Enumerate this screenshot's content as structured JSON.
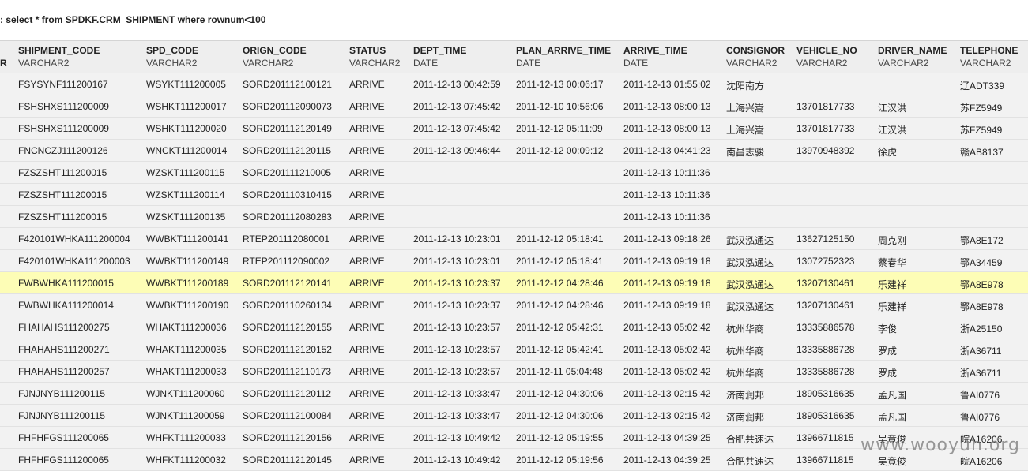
{
  "query_text": ": select * from SPDKF.CRM_SHIPMENT where rownum<100",
  "stub_label": "R",
  "columns": [
    {
      "name": "SHIPMENT_CODE",
      "type": "VARCHAR2"
    },
    {
      "name": "SPD_CODE",
      "type": "VARCHAR2"
    },
    {
      "name": "ORIGN_CODE",
      "type": "VARCHAR2"
    },
    {
      "name": "STATUS",
      "type": "VARCHAR2"
    },
    {
      "name": "DEPT_TIME",
      "type": "DATE"
    },
    {
      "name": "PLAN_ARRIVE_TIME",
      "type": "DATE"
    },
    {
      "name": "ARRIVE_TIME",
      "type": "DATE"
    },
    {
      "name": "CONSIGNOR",
      "type": "VARCHAR2"
    },
    {
      "name": "VEHICLE_NO",
      "type": "VARCHAR2"
    },
    {
      "name": "DRIVER_NAME",
      "type": "VARCHAR2"
    },
    {
      "name": "TELEPHONE",
      "type": "VARCHAR2"
    }
  ],
  "rows": [
    [
      "FSYSYNF111200167",
      "WSYKT111200005",
      "SORD201112100121",
      "ARRIVE",
      "2011-12-13 00:42:59",
      "2011-12-13 00:06:17",
      "2011-12-13 01:55:02",
      "沈阳南方",
      "",
      "",
      "辽ADT339"
    ],
    [
      "FSHSHXS111200009",
      "WSHKT111200017",
      "SORD201112090073",
      "ARRIVE",
      "2011-12-13 07:45:42",
      "2011-12-10 10:56:06",
      "2011-12-13 08:00:13",
      "上海兴嵩",
      "13701817733",
      "江汉洪",
      "苏FZ5949"
    ],
    [
      "FSHSHXS111200009",
      "WSHKT111200020",
      "SORD201112120149",
      "ARRIVE",
      "2011-12-13 07:45:42",
      "2011-12-12 05:11:09",
      "2011-12-13 08:00:13",
      "上海兴嵩",
      "13701817733",
      "江汉洪",
      "苏FZ5949"
    ],
    [
      "FNCNCZJ111200126",
      "WNCKT111200014",
      "SORD201112120115",
      "ARRIVE",
      "2011-12-13 09:46:44",
      "2011-12-12 00:09:12",
      "2011-12-13 04:41:23",
      "南昌志骏",
      "13970948392",
      "徐虎",
      "赣AB8137"
    ],
    [
      "FZSZSHT111200015",
      "WZSKT111200115",
      "SORD201111210005",
      "ARRIVE",
      "",
      "",
      "2011-12-13 10:11:36",
      "",
      "",
      "",
      ""
    ],
    [
      "FZSZSHT111200015",
      "WZSKT111200114",
      "SORD201110310415",
      "ARRIVE",
      "",
      "",
      "2011-12-13 10:11:36",
      "",
      "",
      "",
      ""
    ],
    [
      "FZSZSHT111200015",
      "WZSKT111200135",
      "SORD201112080283",
      "ARRIVE",
      "",
      "",
      "2011-12-13 10:11:36",
      "",
      "",
      "",
      ""
    ],
    [
      "F420101WHKA111200004",
      "WWBKT111200141",
      "RTEP201112080001",
      "ARRIVE",
      "2011-12-13 10:23:01",
      "2011-12-12 05:18:41",
      "2011-12-13 09:18:26",
      "武汉泓通达",
      "13627125150",
      "周克刚",
      "鄂A8E172"
    ],
    [
      "F420101WHKA111200003",
      "WWBKT111200149",
      "RTEP201112090002",
      "ARRIVE",
      "2011-12-13 10:23:01",
      "2011-12-12 05:18:41",
      "2011-12-13 09:19:18",
      "武汉泓通达",
      "13072752323",
      "蔡春华",
      "鄂A34459"
    ],
    [
      "FWBWHKA111200015",
      "WWBKT111200189",
      "SORD201112120141",
      "ARRIVE",
      "2011-12-13 10:23:37",
      "2011-12-12 04:28:46",
      "2011-12-13 09:19:18",
      "武汉泓通达",
      "13207130461",
      "乐建祥",
      "鄂A8E978"
    ],
    [
      "FWBWHKA111200014",
      "WWBKT111200190",
      "SORD201110260134",
      "ARRIVE",
      "2011-12-13 10:23:37",
      "2011-12-12 04:28:46",
      "2011-12-13 09:19:18",
      "武汉泓通达",
      "13207130461",
      "乐建祥",
      "鄂A8E978"
    ],
    [
      "FHAHAHS111200275",
      "WHAKT111200036",
      "SORD201112120155",
      "ARRIVE",
      "2011-12-13 10:23:57",
      "2011-12-12 05:42:31",
      "2011-12-13 05:02:42",
      "杭州华商",
      "13335886578",
      "李俊",
      "浙A25150"
    ],
    [
      "FHAHAHS111200271",
      "WHAKT111200035",
      "SORD201112120152",
      "ARRIVE",
      "2011-12-13 10:23:57",
      "2011-12-12 05:42:41",
      "2011-12-13 05:02:42",
      "杭州华商",
      "13335886728",
      "罗成",
      "浙A36711"
    ],
    [
      "FHAHAHS111200257",
      "WHAKT111200033",
      "SORD201112110173",
      "ARRIVE",
      "2011-12-13 10:23:57",
      "2011-12-11 05:04:48",
      "2011-12-13 05:02:42",
      "杭州华商",
      "13335886728",
      "罗成",
      "浙A36711"
    ],
    [
      "FJNJNYB111200115",
      "WJNKT111200060",
      "SORD201112120112",
      "ARRIVE",
      "2011-12-13 10:33:47",
      "2011-12-12 04:30:06",
      "2011-12-13 02:15:42",
      "济南润邦",
      "18905316635",
      "孟凡国",
      "鲁AI0776"
    ],
    [
      "FJNJNYB111200115",
      "WJNKT111200059",
      "SORD201112100084",
      "ARRIVE",
      "2011-12-13 10:33:47",
      "2011-12-12 04:30:06",
      "2011-12-13 02:15:42",
      "济南润邦",
      "18905316635",
      "孟凡国",
      "鲁AI0776"
    ],
    [
      "FHFHFGS111200065",
      "WHFKT111200033",
      "SORD201112120156",
      "ARRIVE",
      "2011-12-13 10:49:42",
      "2011-12-12 05:19:55",
      "2011-12-13 04:39:25",
      "合肥共速达",
      "13966711815",
      "吴竟俊",
      "皖A16206"
    ],
    [
      "FHFHFGS111200065",
      "WHFKT111200032",
      "SORD201112120145",
      "ARRIVE",
      "2011-12-13 10:49:42",
      "2011-12-12 05:19:56",
      "2011-12-13 04:39:25",
      "合肥共速达",
      "13966711815",
      "吴竟俊",
      "皖A16206"
    ]
  ],
  "selected_row": 9,
  "watermark": "www.wooyun.org"
}
